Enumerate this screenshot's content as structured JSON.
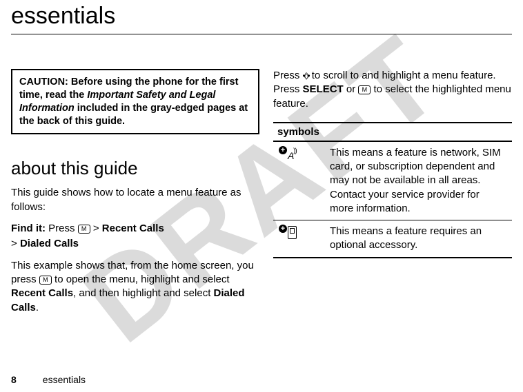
{
  "watermark": "DRAFT",
  "page_title": "essentials",
  "caution": {
    "prefix": "CAUTION:",
    "before": " Before using the phone for the first time, read the ",
    "emph": "Important Safety and Legal Information",
    "after": " included in the gray-edged pages at the back of this guide."
  },
  "section_heading": "about this guide",
  "intro_para": "This guide shows how to locate a menu feature as follows:",
  "find_it": {
    "label": "Find it:",
    "press": " Press ",
    "key_menu": "M",
    "sep": " > ",
    "item1": "Recent Calls",
    "sep2": "> ",
    "item2": "Dialed Calls"
  },
  "example_para": {
    "p1": "This example shows that, from the home screen, you press ",
    "key": "M",
    "p2": " to open the menu, highlight and select ",
    "b1": "Recent Calls",
    "p3": ", and then highlight and select ",
    "b2": "Dialed Calls",
    "p4": "."
  },
  "right_para": {
    "p1": "Press ",
    "nav": "•ộ•",
    "p2": " to scroll to and highlight a menu feature. Press ",
    "select": "SELECT",
    "p3": " or ",
    "key": "M",
    "p4": " to select the highlighted menu feature."
  },
  "symbols": {
    "header": "symbols",
    "rows": [
      {
        "icon": "network",
        "text": "This means a feature is network, SIM card, or subscription dependent and may not be available in all areas. Contact your service provider for more information."
      },
      {
        "icon": "accessory",
        "text": "This means a feature requires an optional accessory."
      }
    ]
  },
  "footer": {
    "page": "8",
    "label": "essentials"
  }
}
